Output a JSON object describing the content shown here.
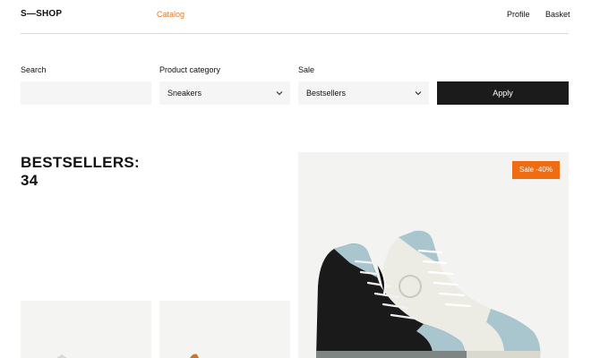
{
  "header": {
    "logo": "S—SHOP",
    "nav": {
      "catalog": "Catalog",
      "profile": "Profile",
      "basket": "Basket"
    },
    "accent_color": "#e07a2c"
  },
  "filters": {
    "search": {
      "label": "Search",
      "value": "",
      "placeholder": ""
    },
    "category": {
      "label": "Product category",
      "selected": "Sneakers"
    },
    "sale": {
      "label": "Sale",
      "selected": "Bestsellers"
    },
    "apply_label": "Apply"
  },
  "section": {
    "title_line1": "BESTSELLERS:",
    "title_line2": "34"
  },
  "products": [
    {
      "badge": "Sale -40%",
      "badge_color": "#ef6c12",
      "image": "high-top-sneakers"
    },
    {
      "image": "sneaker-partial-1"
    },
    {
      "image": "sneaker-partial-2"
    }
  ]
}
